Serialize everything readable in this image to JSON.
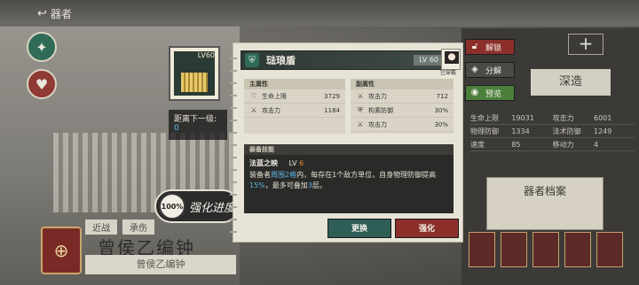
{
  "topbar": {
    "back_label": "器者"
  },
  "sidebar": {
    "icon1_caption": "",
    "icon2_caption": ""
  },
  "background": {
    "tabs": [
      "近战",
      "承伤"
    ],
    "hero_name": "曾侯乙编钟",
    "hero_subname": "曾侯乙编钟",
    "craft_label": "深造",
    "archive_label": "器者档案",
    "top_right_symbol": "+",
    "stats": [
      {
        "k": "生命上限",
        "v": "19031",
        "k2": "攻击力",
        "v2": "6001"
      },
      {
        "k": "物理防御",
        "v": "1334",
        "k2": "法术防御",
        "v2": "1249"
      },
      {
        "k": "速度",
        "v": "85",
        "k2": "移动力",
        "v2": "4"
      }
    ]
  },
  "equip_thumb": {
    "level": "LV60"
  },
  "distance": {
    "label": "距离下一级:",
    "value": "0"
  },
  "enhance": {
    "percent": "100%",
    "label": "强化进度"
  },
  "panel": {
    "equip_name": "琺琅盾",
    "level": "LV 60",
    "owner_tag": "已穿戴",
    "main_attr": {
      "title": "主属性",
      "rows": [
        {
          "icon": "heart-icon",
          "k": "生命上限",
          "v": "3729"
        },
        {
          "icon": "swords-icon",
          "k": "攻击力",
          "v": "1184"
        }
      ]
    },
    "sub_attr": {
      "title": "副属性",
      "rows": [
        {
          "icon": "swords-icon",
          "k": "攻击力",
          "v": "712"
        },
        {
          "icon": "shield-icon",
          "k": "构素防御",
          "v": "30%"
        },
        {
          "icon": "swords-icon",
          "k": "攻击力",
          "v": "30%"
        }
      ]
    },
    "skill": {
      "title": "装备技能",
      "name": "法蓝之映",
      "lv_label": "LV",
      "lv_value": "6",
      "desc_1": "装备者",
      "desc_hl1": "周围2格",
      "desc_2": "内，每存在1个敌方单位，自身物理防御提高",
      "desc_hl2": "15%",
      "desc_3": "，最多可叠加",
      "desc_hl3": "3",
      "desc_4": "层。"
    },
    "btn_replace": "更换",
    "btn_strengthen": "强化"
  },
  "side_actions": {
    "unlock": "解锁",
    "decompose": "分解",
    "preview": "预览"
  },
  "colors": {
    "accent_green": "#2f5e57",
    "accent_red": "#8c2f2b",
    "highlight_blue": "#5eb6e6",
    "level_orange": "#e88a3a"
  }
}
